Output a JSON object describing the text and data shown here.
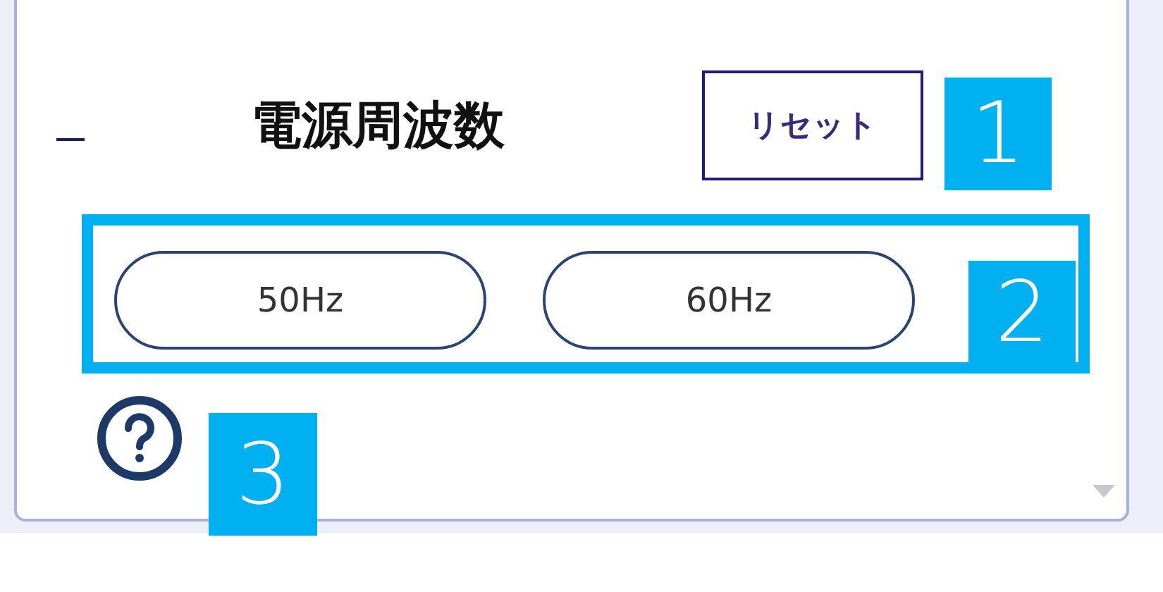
{
  "setting": {
    "title": "電源周波数",
    "reset_button": "リセット"
  },
  "options": [
    {
      "label": "50Hz"
    },
    {
      "label": "60Hz"
    }
  ],
  "callouts": [
    "1",
    "2",
    "3"
  ]
}
